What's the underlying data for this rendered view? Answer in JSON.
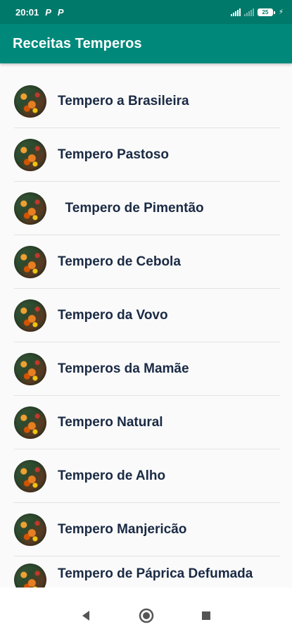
{
  "status_bar": {
    "time": "20:01",
    "notif_1": "P",
    "notif_2": "P",
    "battery": "25"
  },
  "app_bar": {
    "title": "Receitas Temperos"
  },
  "list": {
    "items": [
      {
        "label": "Tempero a Brasileira"
      },
      {
        "label": "Tempero Pastoso"
      },
      {
        "label": "  Tempero de Pimentão"
      },
      {
        "label": "Tempero de Cebola"
      },
      {
        "label": "Tempero da Vovo"
      },
      {
        "label": "Temperos da Mamãe"
      },
      {
        "label": "Tempero Natural"
      },
      {
        "label": "Tempero de Alho"
      },
      {
        "label": "Tempero Manjericão"
      },
      {
        "label": "Tempero de Páprica Defumada"
      }
    ]
  },
  "nav_bar": {
    "back_icon": "back-triangle",
    "home_icon": "home-circle",
    "recent_icon": "recents-square"
  },
  "colors": {
    "status_bar": "#00796b",
    "app_bar": "#00897b",
    "item_text": "#1a2a44"
  }
}
